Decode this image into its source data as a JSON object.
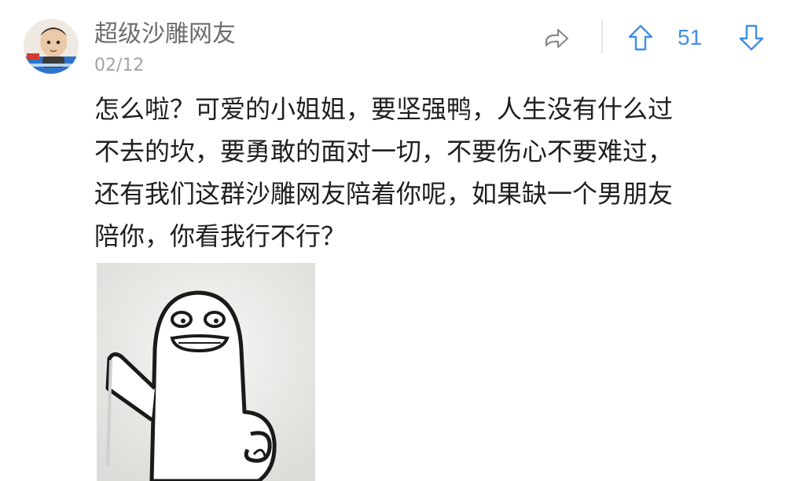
{
  "comment": {
    "username": "超级沙雕网友",
    "date": "02/12",
    "vote_count": "51",
    "text": "怎么啦？可爱的小姐姐，要坚强鸭，人生没有什么过\n不去的坎，要勇敢的面对一切，不要伤心不要难过，\n还有我们这群沙雕网友陪着你呢，如果缺一个男朋友\n陪你，你看我行不行？"
  },
  "icons": {
    "share": "share-icon",
    "upvote": "arrow-up-icon",
    "downvote": "arrow-down-icon"
  },
  "colors": {
    "accent": "#3f8ee7",
    "username": "#6d6d6d",
    "date": "#a3a3a3",
    "text": "#1f1f1f"
  }
}
